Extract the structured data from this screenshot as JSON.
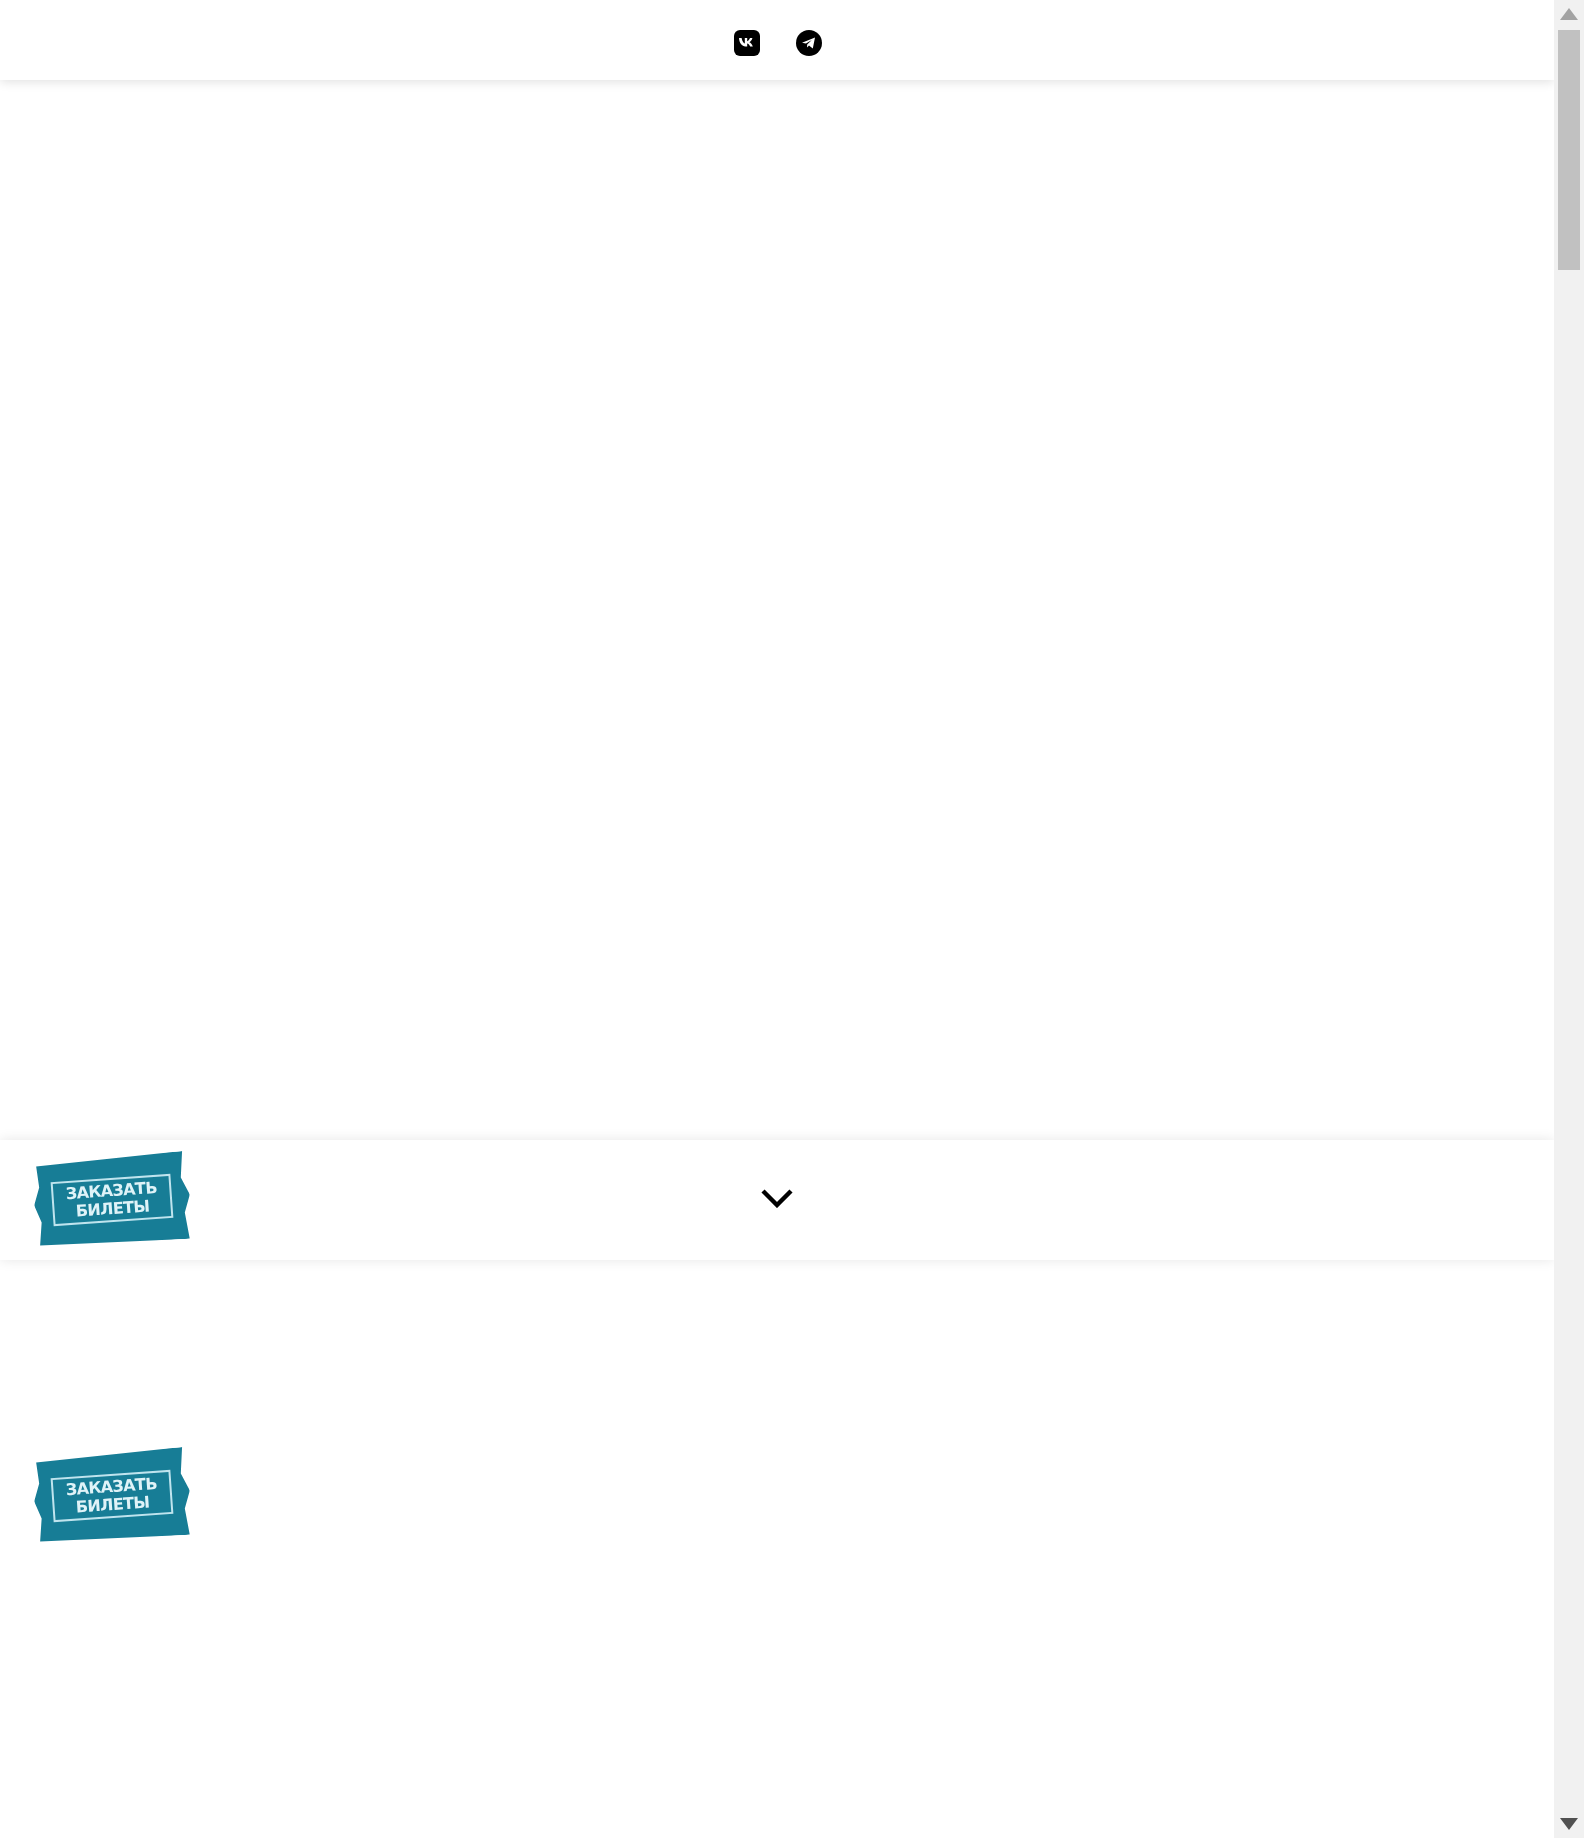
{
  "header": {
    "social_links": [
      {
        "kind": "vk"
      },
      {
        "kind": "telegram"
      }
    ]
  },
  "sticky_bar": {
    "ticket_button": {
      "line_1": "ЗАКАЗАТЬ",
      "line_2": "БИЛЕТЫ"
    }
  },
  "content": {
    "ticket_button": {
      "line_1": "ЗАКАЗАТЬ",
      "line_2": "БИЛЕТЫ"
    }
  }
}
